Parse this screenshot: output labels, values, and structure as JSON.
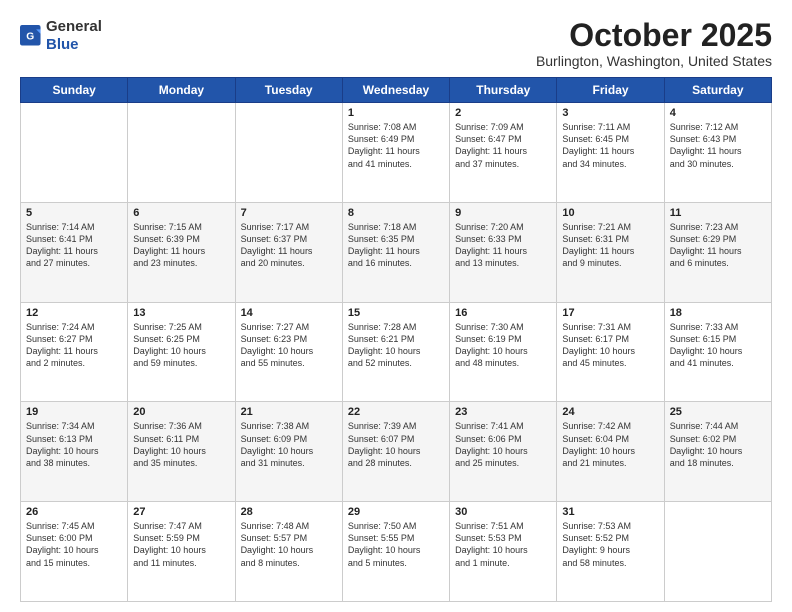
{
  "header": {
    "logo_line1": "General",
    "logo_line2": "Blue",
    "month": "October 2025",
    "location": "Burlington, Washington, United States"
  },
  "days_of_week": [
    "Sunday",
    "Monday",
    "Tuesday",
    "Wednesday",
    "Thursday",
    "Friday",
    "Saturday"
  ],
  "weeks": [
    [
      {
        "day": "",
        "text": ""
      },
      {
        "day": "",
        "text": ""
      },
      {
        "day": "",
        "text": ""
      },
      {
        "day": "1",
        "text": "Sunrise: 7:08 AM\nSunset: 6:49 PM\nDaylight: 11 hours\nand 41 minutes."
      },
      {
        "day": "2",
        "text": "Sunrise: 7:09 AM\nSunset: 6:47 PM\nDaylight: 11 hours\nand 37 minutes."
      },
      {
        "day": "3",
        "text": "Sunrise: 7:11 AM\nSunset: 6:45 PM\nDaylight: 11 hours\nand 34 minutes."
      },
      {
        "day": "4",
        "text": "Sunrise: 7:12 AM\nSunset: 6:43 PM\nDaylight: 11 hours\nand 30 minutes."
      }
    ],
    [
      {
        "day": "5",
        "text": "Sunrise: 7:14 AM\nSunset: 6:41 PM\nDaylight: 11 hours\nand 27 minutes."
      },
      {
        "day": "6",
        "text": "Sunrise: 7:15 AM\nSunset: 6:39 PM\nDaylight: 11 hours\nand 23 minutes."
      },
      {
        "day": "7",
        "text": "Sunrise: 7:17 AM\nSunset: 6:37 PM\nDaylight: 11 hours\nand 20 minutes."
      },
      {
        "day": "8",
        "text": "Sunrise: 7:18 AM\nSunset: 6:35 PM\nDaylight: 11 hours\nand 16 minutes."
      },
      {
        "day": "9",
        "text": "Sunrise: 7:20 AM\nSunset: 6:33 PM\nDaylight: 11 hours\nand 13 minutes."
      },
      {
        "day": "10",
        "text": "Sunrise: 7:21 AM\nSunset: 6:31 PM\nDaylight: 11 hours\nand 9 minutes."
      },
      {
        "day": "11",
        "text": "Sunrise: 7:23 AM\nSunset: 6:29 PM\nDaylight: 11 hours\nand 6 minutes."
      }
    ],
    [
      {
        "day": "12",
        "text": "Sunrise: 7:24 AM\nSunset: 6:27 PM\nDaylight: 11 hours\nand 2 minutes."
      },
      {
        "day": "13",
        "text": "Sunrise: 7:25 AM\nSunset: 6:25 PM\nDaylight: 10 hours\nand 59 minutes."
      },
      {
        "day": "14",
        "text": "Sunrise: 7:27 AM\nSunset: 6:23 PM\nDaylight: 10 hours\nand 55 minutes."
      },
      {
        "day": "15",
        "text": "Sunrise: 7:28 AM\nSunset: 6:21 PM\nDaylight: 10 hours\nand 52 minutes."
      },
      {
        "day": "16",
        "text": "Sunrise: 7:30 AM\nSunset: 6:19 PM\nDaylight: 10 hours\nand 48 minutes."
      },
      {
        "day": "17",
        "text": "Sunrise: 7:31 AM\nSunset: 6:17 PM\nDaylight: 10 hours\nand 45 minutes."
      },
      {
        "day": "18",
        "text": "Sunrise: 7:33 AM\nSunset: 6:15 PM\nDaylight: 10 hours\nand 41 minutes."
      }
    ],
    [
      {
        "day": "19",
        "text": "Sunrise: 7:34 AM\nSunset: 6:13 PM\nDaylight: 10 hours\nand 38 minutes."
      },
      {
        "day": "20",
        "text": "Sunrise: 7:36 AM\nSunset: 6:11 PM\nDaylight: 10 hours\nand 35 minutes."
      },
      {
        "day": "21",
        "text": "Sunrise: 7:38 AM\nSunset: 6:09 PM\nDaylight: 10 hours\nand 31 minutes."
      },
      {
        "day": "22",
        "text": "Sunrise: 7:39 AM\nSunset: 6:07 PM\nDaylight: 10 hours\nand 28 minutes."
      },
      {
        "day": "23",
        "text": "Sunrise: 7:41 AM\nSunset: 6:06 PM\nDaylight: 10 hours\nand 25 minutes."
      },
      {
        "day": "24",
        "text": "Sunrise: 7:42 AM\nSunset: 6:04 PM\nDaylight: 10 hours\nand 21 minutes."
      },
      {
        "day": "25",
        "text": "Sunrise: 7:44 AM\nSunset: 6:02 PM\nDaylight: 10 hours\nand 18 minutes."
      }
    ],
    [
      {
        "day": "26",
        "text": "Sunrise: 7:45 AM\nSunset: 6:00 PM\nDaylight: 10 hours\nand 15 minutes."
      },
      {
        "day": "27",
        "text": "Sunrise: 7:47 AM\nSunset: 5:59 PM\nDaylight: 10 hours\nand 11 minutes."
      },
      {
        "day": "28",
        "text": "Sunrise: 7:48 AM\nSunset: 5:57 PM\nDaylight: 10 hours\nand 8 minutes."
      },
      {
        "day": "29",
        "text": "Sunrise: 7:50 AM\nSunset: 5:55 PM\nDaylight: 10 hours\nand 5 minutes."
      },
      {
        "day": "30",
        "text": "Sunrise: 7:51 AM\nSunset: 5:53 PM\nDaylight: 10 hours\nand 1 minute."
      },
      {
        "day": "31",
        "text": "Sunrise: 7:53 AM\nSunset: 5:52 PM\nDaylight: 9 hours\nand 58 minutes."
      },
      {
        "day": "",
        "text": ""
      }
    ]
  ]
}
